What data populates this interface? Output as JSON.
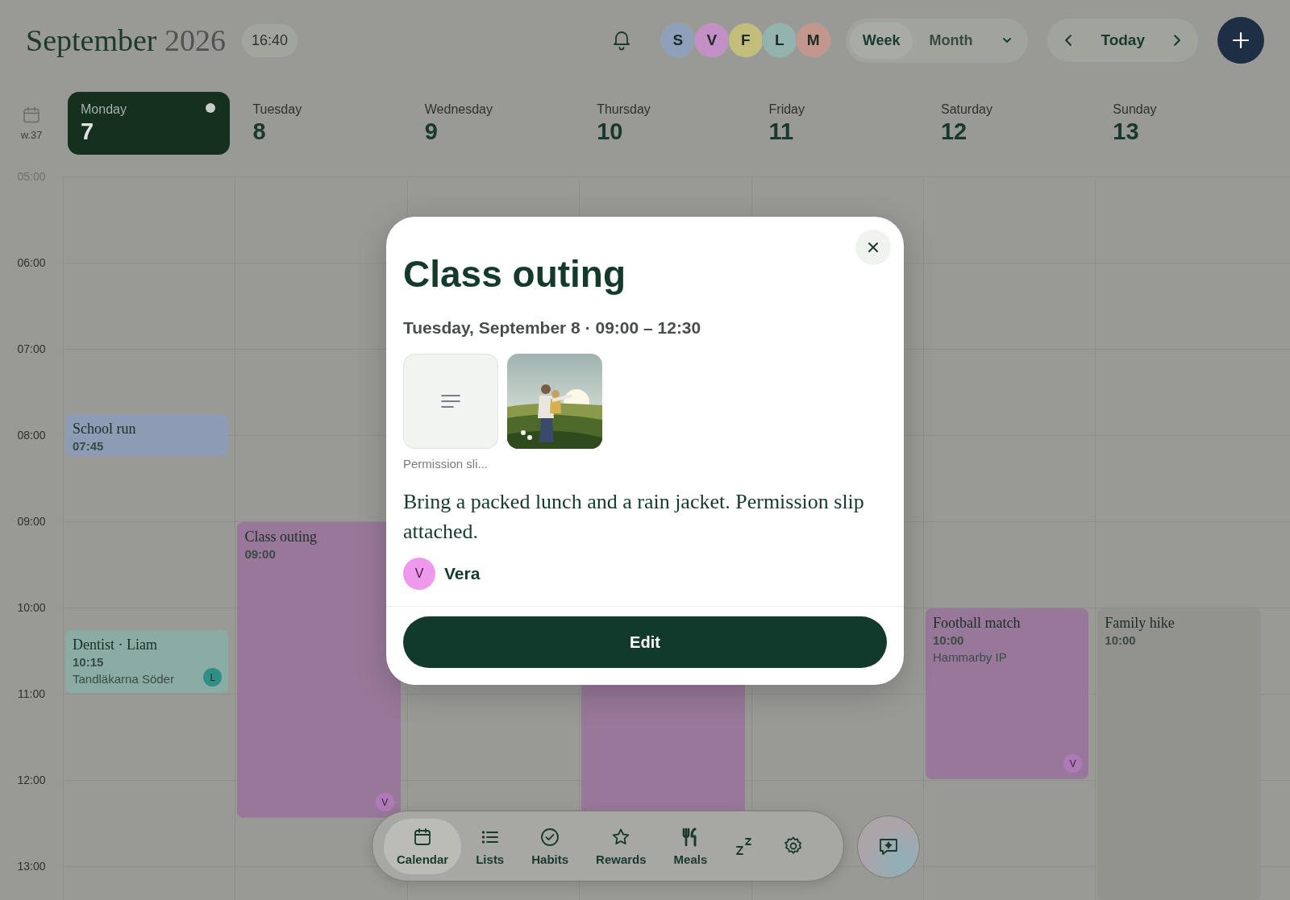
{
  "header": {
    "month": "September",
    "year": "2026",
    "clock": "16:40"
  },
  "members": [
    {
      "initial": "S",
      "color": "#8fa0bb"
    },
    {
      "initial": "V",
      "color": "#c390c6"
    },
    {
      "initial": "F",
      "color": "#c4be7c"
    },
    {
      "initial": "L",
      "color": "#93b4ae"
    },
    {
      "initial": "M",
      "color": "#c3968e"
    }
  ],
  "view_switch": [
    {
      "label": "Week",
      "selected": true
    },
    {
      "label": "Month",
      "selected": false
    }
  ],
  "date_nav": {
    "today": "Today"
  },
  "week": {
    "label": "w.37"
  },
  "hours": [
    "05:00",
    "06:00",
    "07:00",
    "08:00",
    "09:00",
    "10:00",
    "11:00",
    "12:00",
    "13:00"
  ],
  "days": [
    {
      "name": "Monday",
      "date": "7",
      "selected": true,
      "events": [
        {
          "title": "School run",
          "time": "07:45",
          "color": "#8d9cb4"
        },
        {
          "title": "Dentist · Liam",
          "time": "10:15",
          "place": "Tandläkarna Söder",
          "color": "#8aaca4",
          "assignee": {
            "initial": "L",
            "color": "#2f8f86"
          }
        }
      ]
    },
    {
      "name": "Tuesday",
      "date": "8",
      "selected": false,
      "events": [
        {
          "title": "Class outing",
          "time": "09:00",
          "color": "#98789a",
          "assignee": {
            "initial": "V",
            "color": "#b07ab8"
          }
        }
      ]
    },
    {
      "name": "Wednesday",
      "date": "9",
      "selected": false
    },
    {
      "name": "Thursday",
      "date": "10",
      "selected": false,
      "events": [
        {
          "color": "#98789a"
        }
      ]
    },
    {
      "name": "Friday",
      "date": "11",
      "selected": false
    },
    {
      "name": "Saturday",
      "date": "12",
      "selected": false,
      "events": [
        {
          "title": "Football match",
          "time": "10:00",
          "place": "Hammarby IP",
          "color": "#98789a",
          "assignee": {
            "initial": "V",
            "color": "#b07ab8"
          }
        }
      ]
    },
    {
      "name": "Sunday",
      "date": "13",
      "selected": false,
      "events": [
        {
          "title": "Family hike",
          "time": "10:00",
          "color": "#93938e"
        }
      ]
    }
  ],
  "event_dialog": {
    "title": "Class outing",
    "when": "Tuesday, September 8 · 09:00 – 12:30",
    "attachments": [
      {
        "kind": "document",
        "caption": "Permission sli..."
      },
      {
        "kind": "picture"
      }
    ],
    "note": "Bring a packed lunch and a rain jacket. Permission slip attached.",
    "assignee": {
      "initial": "V",
      "name": "Vera",
      "color": "#ee99ee"
    },
    "action": "Edit"
  },
  "bottom_nav": [
    {
      "kind": "calendar",
      "label": "Calendar",
      "selected": true
    },
    {
      "kind": "lists",
      "label": "Lists",
      "selected": false
    },
    {
      "kind": "habits",
      "label": "Habits",
      "selected": false
    },
    {
      "kind": "rewards",
      "label": "Rewards",
      "selected": false
    },
    {
      "kind": "meals",
      "label": "Meals",
      "selected": false
    },
    {
      "kind": "sleep",
      "selected": false
    },
    {
      "kind": "settings",
      "selected": false
    }
  ]
}
